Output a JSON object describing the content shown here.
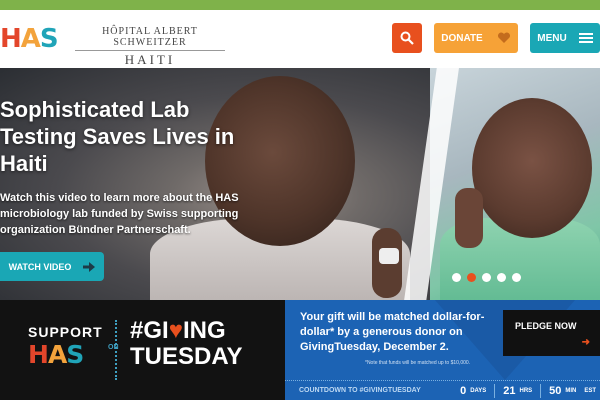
{
  "colors": {
    "orange": "#e8501e",
    "amber": "#f6a237",
    "teal": "#1aa7b5",
    "blue": "#1c63b4",
    "green": "#7fb24a"
  },
  "logo": {
    "h": "H",
    "a": "A",
    "s": "S",
    "line1": "HÔPITAL ALBERT SCHWEITZER",
    "line2": "HAITI"
  },
  "header": {
    "search_icon": "search-icon",
    "donate_label": "DONATE",
    "donate_icon": "heart-icon",
    "menu_label": "MENU",
    "menu_icon": "hamburger-icon"
  },
  "hero": {
    "title": "Sophisticated Lab Testing Saves Lives in Haiti",
    "description": "Watch this video to learn more about the HAS microbiology lab funded by Swiss supporting organization Bündner Partnerschaft.",
    "watch_label": "WATCH VIDEO",
    "watch_icon": "arrow-right-icon",
    "slides": 5,
    "active_slide": 2
  },
  "banner": {
    "support": "SUPPORT",
    "on": "ON",
    "hash_giving_prefix": "#GI",
    "hash_giving_suffix": "ING",
    "tuesday": "TUESDAY",
    "gift_text": "Your gift will be matched dollar-for-dollar* by a generous donor on GivingTuesday, December 2.",
    "note": "*Note that funds will be matched up to $10,000.",
    "pledge_label": "PLEDGE NOW",
    "countdown_label": "COUNTDOWN TO #GIVINGTUESDAY",
    "days": "0",
    "days_unit": "DAYS",
    "hours": "21",
    "hours_unit": "HRS",
    "minutes": "50",
    "minutes_unit": "MIN",
    "tz": "EST"
  }
}
